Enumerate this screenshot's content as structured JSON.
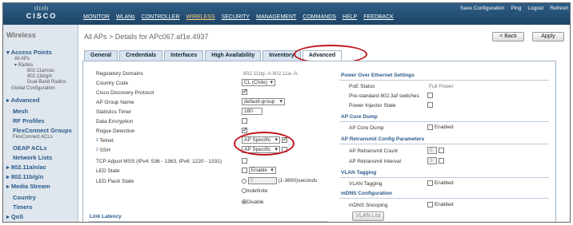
{
  "header": {
    "logo_bars": "ılıılı",
    "logo_word": "CISCO",
    "nav": [
      "MONITOR",
      "WLANs",
      "CONTROLLER",
      "WIRELESS",
      "SECURITY",
      "MANAGEMENT",
      "COMMANDS",
      "HELP",
      "FEEDBACK"
    ],
    "active_nav": "WIRELESS",
    "links": [
      "Save Configuration",
      "Ping",
      "Logout",
      "Refresh"
    ]
  },
  "sidebar": {
    "title": "Wireless",
    "access_points": "Access Points",
    "all_aps": "All APs",
    "radios": "Radios",
    "radio_a": "802.11a/n/ac",
    "radio_b": "802.11b/g/n",
    "dual_band": "Dual-Band Radios",
    "global_config": "Global Configuration",
    "advanced": "Advanced",
    "mesh": "Mesh",
    "rf_profiles": "RF Profiles",
    "flexconnect_groups": "FlexConnect Groups",
    "flexconnect_acls_sub": "FlexConnect ACLs",
    "oeap_acls": "OEAP ACLs",
    "network_lists": "Network Lists",
    "n80211a": "802.11a/n/ac",
    "n80211b": "802.11b/g/n",
    "media_stream": "Media Stream",
    "country": "Country",
    "timers": "Timers",
    "qos": "QoS"
  },
  "main": {
    "breadcrumb": "All APs > Details for APc067.af1e.4937",
    "back_label": "< Back",
    "apply_label": "Apply",
    "tabs": [
      "General",
      "Credentials",
      "Interfaces",
      "High Availability",
      "Inventory",
      "Advanced"
    ],
    "active_tab": "Advanced"
  },
  "left": {
    "regulatory_domains_label": "Regulatory Domains",
    "regulatory_domains_value": "802.11bg:-A   802.11a:-A",
    "country_code_label": "Country Code",
    "country_code_value": "CL (Chile)",
    "cdp_label": "Cisco Discovery Protocol",
    "ap_group_label": "AP Group Name",
    "ap_group_value": "default-group",
    "stats_timer_label": "Statistics Timer",
    "stats_timer_value": "180",
    "data_encryption_label": "Data Encryption",
    "rogue_detection_label": "Rogue Detection",
    "telnet_sup": "2",
    "telnet_label": "Telnet",
    "telnet_value": "AP Specific",
    "ssh_sup": "2",
    "ssh_label": "SSH",
    "ssh_value": "AP Specific",
    "tcp_mss_label": "TCP Adjust MSS (IPv4: 536 - 1363, IPv6: 1220 - 1331)",
    "led_state_label": "LED State",
    "led_state_value": "Enable",
    "led_flash_label": "LED Flash State",
    "led_flash_input": "0",
    "led_flash_units": "(1-3600)seconds",
    "indefinite_label": "Indefinite",
    "disable_label": "Disable",
    "link_latency": "Link Latency"
  },
  "right": {
    "poe_title": "Power Over Ethernet Settings",
    "poe_status_label": "PoE Status",
    "poe_status_value": "Full Power",
    "prestandard_label": "Pre-standard 802.3af switches",
    "power_injector_label": "Power Injector State",
    "core_dump_title": "AP Core Dump",
    "core_dump_label": "AP Core Dump",
    "core_dump_enabled": "Enabled",
    "retransmit_title": "AP Retransmit Config Parameters",
    "retransmit_count_label": "AP Retransmit Count",
    "retransmit_count_value": "5",
    "retransmit_interval_label": "AP Retransmit Interval",
    "retransmit_interval_value": "3",
    "vlan_title": "VLAN Tagging",
    "vlan_label": "VLAN Tagging",
    "vlan_enabled": "Enabled",
    "mdns_title": "mDNS Configuration",
    "mdns_label": "mDNS Snooping",
    "mdns_enabled": "Enabled",
    "vlan_list_button": "VLAN List"
  },
  "colors": {
    "header_bg": "#1e4466",
    "highlight_ellipse": "#c0141c",
    "link": "#2a5a8a"
  }
}
